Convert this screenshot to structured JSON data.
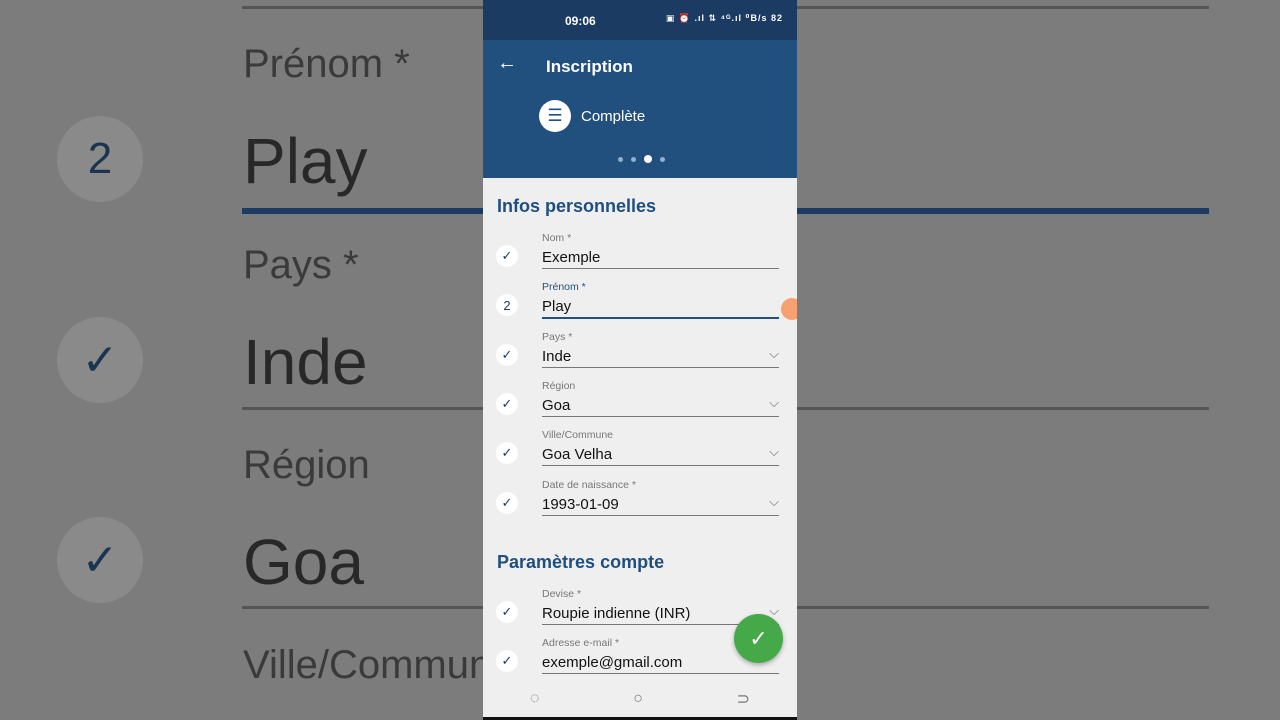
{
  "header": {
    "time": "09:06",
    "status_right": "▣ ⏰ .ıl ⇅ ⁴ᴳ.ıl ⁰B/s 82",
    "title": "Inscription",
    "step_label": "Complète",
    "step_count": 4,
    "active_step": 3
  },
  "sections": {
    "personal": "Infos personnelles",
    "account": "Paramètres compte"
  },
  "fields": [
    {
      "label": "Nom *",
      "value": "Exemple",
      "status": "check",
      "dropdown": false
    },
    {
      "label": "Prénom *",
      "value": "Play",
      "status": "2",
      "dropdown": false,
      "active": true
    },
    {
      "label": "Pays *",
      "value": "Inde",
      "status": "check",
      "dropdown": true
    },
    {
      "label": "Région",
      "value": "Goa",
      "status": "check",
      "dropdown": true
    },
    {
      "label": "Ville/Commune",
      "value": "Goa Velha",
      "status": "check",
      "dropdown": true
    },
    {
      "label": "Date de naissance *",
      "value": "1993-01-09",
      "status": "check",
      "dropdown": true
    }
  ],
  "account_fields": [
    {
      "label": "Devise *",
      "value": "Roupie indienne (INR)",
      "status": "check",
      "dropdown": true
    },
    {
      "label": "Adresse e-mail *",
      "value": "exemple@gmail.com",
      "status": "check",
      "dropdown": false
    }
  ],
  "icons": {
    "check": "✓",
    "chevron": "⌵",
    "back": "←",
    "list": "☰",
    "fab": "✓"
  },
  "colors": {
    "primary": "#21507f",
    "status_bar": "#1b3b63",
    "fab": "#45a94a"
  }
}
